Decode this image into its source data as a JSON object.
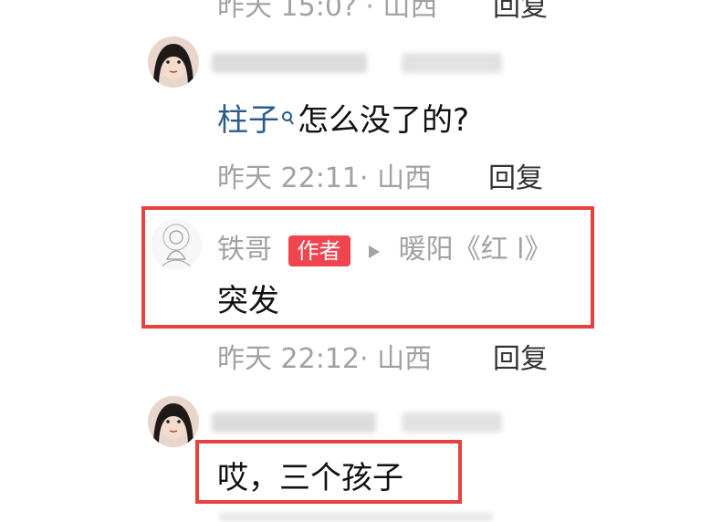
{
  "comments": [
    {
      "time_location": "昨天 15:0? · 山西",
      "reply_label": "回复"
    },
    {
      "mention": "柱子",
      "text": "怎么没了的?",
      "time_location": "昨天 22:11· 山西",
      "reply_label": "回复"
    },
    {
      "author": "铁哥",
      "author_badge": "作者",
      "reply_to": "暖阳《红 l》",
      "text": "突发",
      "time_location": "昨天 22:12· 山西",
      "reply_label": "回复"
    },
    {
      "text": "哎，三个孩子"
    }
  ],
  "colors": {
    "highlight": "#e8423f",
    "badge": "#f0444f",
    "link": "#2a5b8c",
    "meta": "#a2a2a2"
  }
}
